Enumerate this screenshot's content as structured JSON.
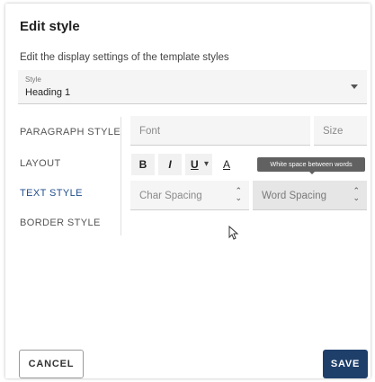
{
  "dialog": {
    "title": "Edit style",
    "subtitle": "Edit the display settings of the template styles"
  },
  "style_select": {
    "label": "Style",
    "value": "Heading 1"
  },
  "nav": {
    "items": [
      {
        "label": "PARAGRAPH STYLE",
        "active": false
      },
      {
        "label": "LAYOUT",
        "active": false
      },
      {
        "label": "TEXT STYLE",
        "active": true
      },
      {
        "label": "BORDER STYLE",
        "active": false
      }
    ]
  },
  "text_style": {
    "font_placeholder": "Font",
    "size_placeholder": "Size",
    "bold_label": "B",
    "italic_label": "I",
    "underline_label": "U",
    "font_color_label": "A",
    "char_spacing_placeholder": "Char Spacing",
    "word_spacing_placeholder": "Word Spacing",
    "tooltip": "White space between words"
  },
  "actions": {
    "cancel_label": "CANCEL",
    "save_label": "SAVE"
  },
  "colors": {
    "accent": "#1f3f6b",
    "active_nav": "#1e4e8c",
    "tooltip_bg": "#616161"
  }
}
